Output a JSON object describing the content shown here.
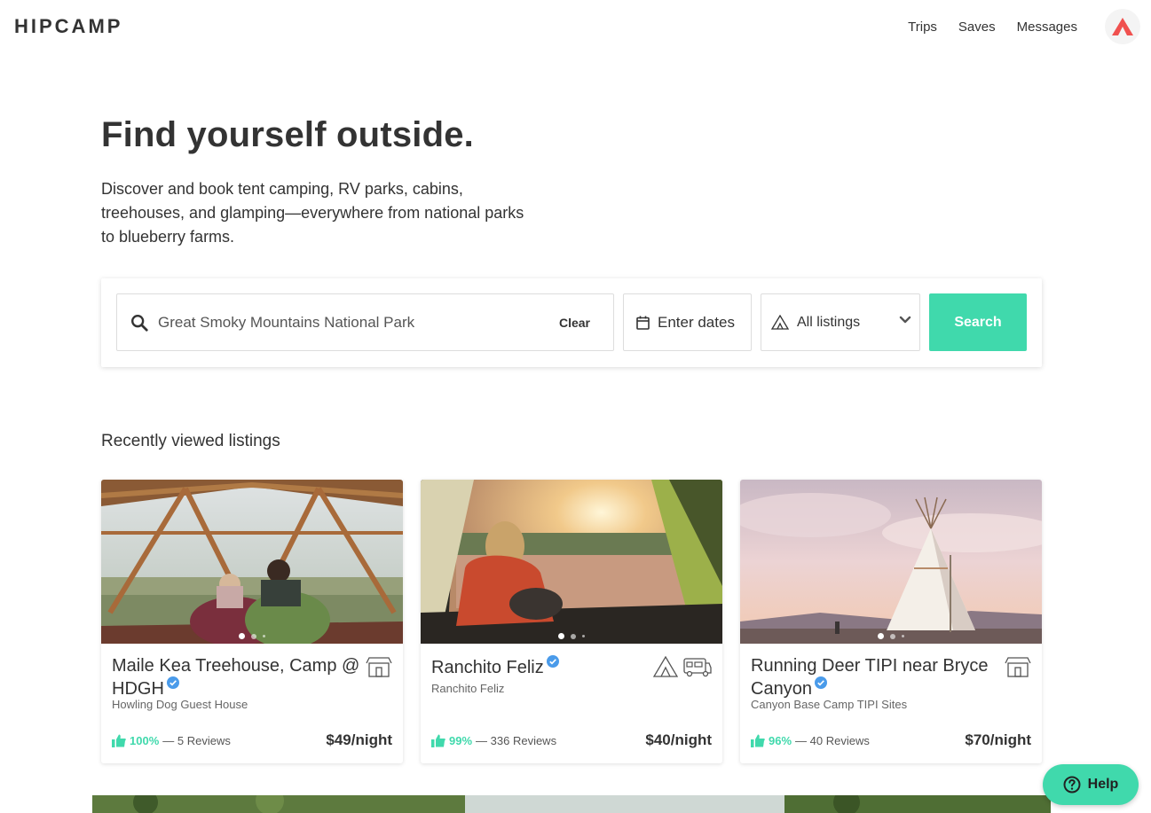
{
  "header": {
    "logo": "HIPCAMP",
    "nav": [
      "Trips",
      "Saves",
      "Messages"
    ]
  },
  "hero": {
    "title": "Find yourself outside.",
    "subtitle": "Discover and book tent camping, RV parks, cabins, treehouses, and glamping—everywhere from national parks to blueberry farms."
  },
  "search": {
    "location_value": "Great Smoky Mountains National Park",
    "clear_label": "Clear",
    "dates_placeholder": "Enter dates",
    "listing_type": "All listings",
    "search_label": "Search"
  },
  "recent": {
    "title": "Recently viewed listings",
    "cards": [
      {
        "name": "Maile Kea Treehouse, Camp @ HDGH",
        "host": "Howling Dog Guest House",
        "rating_pct": "100%",
        "reviews": "— 5 Reviews",
        "price": "$49/night",
        "icons": [
          "cabin-icon"
        ]
      },
      {
        "name": "Ranchito Feliz",
        "host": "Ranchito Feliz",
        "rating_pct": "99%",
        "reviews": "— 336 Reviews",
        "price": "$40/night",
        "icons": [
          "tent-icon",
          "rv-icon"
        ]
      },
      {
        "name": "Running Deer TIPI near Bryce Canyon",
        "host": "Canyon Base Camp TIPI Sites",
        "rating_pct": "96%",
        "reviews": "— 40 Reviews",
        "price": "$70/night",
        "icons": [
          "cabin-icon"
        ]
      }
    ]
  },
  "help": {
    "label": "Help"
  },
  "colors": {
    "accent": "#40d9ac",
    "brand_logo": "#f0514f",
    "verified": "#4a9bea"
  }
}
